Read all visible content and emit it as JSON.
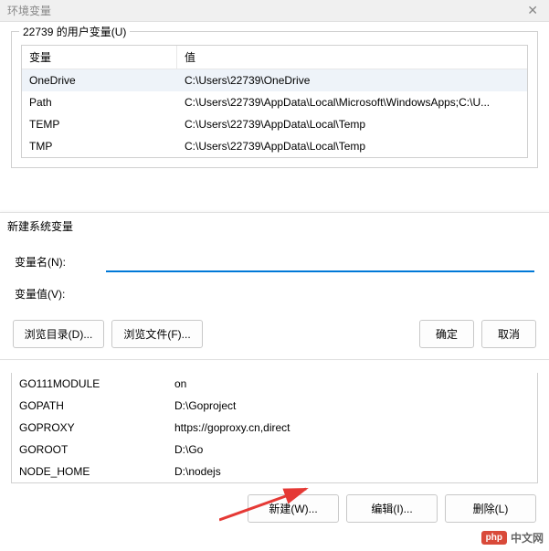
{
  "dialog": {
    "title": "环境变量"
  },
  "user_vars": {
    "legend": "22739 的用户变量(U)",
    "headers": {
      "name": "变量",
      "value": "值"
    },
    "rows": [
      {
        "name": "OneDrive",
        "value": "C:\\Users\\22739\\OneDrive",
        "selected": true
      },
      {
        "name": "Path",
        "value": "C:\\Users\\22739\\AppData\\Local\\Microsoft\\WindowsApps;C:\\U..."
      },
      {
        "name": "TEMP",
        "value": "C:\\Users\\22739\\AppData\\Local\\Temp"
      },
      {
        "name": "TMP",
        "value": "C:\\Users\\22739\\AppData\\Local\\Temp"
      }
    ]
  },
  "new_var_dialog": {
    "title": "新建系统变量",
    "name_label": "变量名(N):",
    "value_label": "变量值(V):",
    "name_value": "",
    "value_value": "",
    "browse_dir": "浏览目录(D)...",
    "browse_file": "浏览文件(F)...",
    "ok": "确定",
    "cancel": "取消"
  },
  "sys_vars": {
    "rows": [
      {
        "name": "GO111MODULE",
        "value": "on"
      },
      {
        "name": "GOPATH",
        "value": "D:\\Goproject"
      },
      {
        "name": "GOPROXY",
        "value": "https://goproxy.cn,direct"
      },
      {
        "name": "GOROOT",
        "value": "D:\\Go"
      },
      {
        "name": "NODE_HOME",
        "value": "D:\\nodejs"
      }
    ]
  },
  "buttons": {
    "new": "新建(W)...",
    "edit": "编辑(I)...",
    "delete": "删除(L)"
  },
  "watermark": {
    "badge": "php",
    "text": "中文网"
  }
}
